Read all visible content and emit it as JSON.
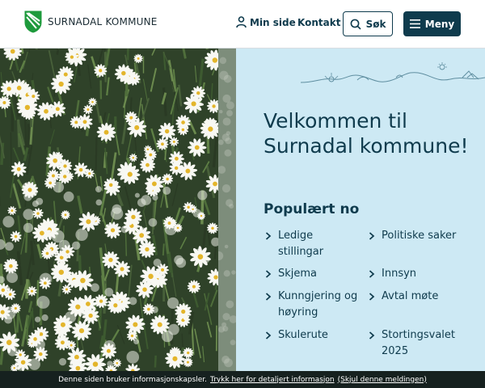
{
  "header": {
    "logo_text": "SURNADAL KOMMUNE",
    "min_side": "Min side",
    "kontakt": "Kontakt",
    "sok": "Søk",
    "meny": "Meny"
  },
  "hero": {
    "title": "Velkommen til Surnadal kommune!"
  },
  "popular": {
    "title": "Populært no",
    "links": [
      "Ledige stillingar",
      "Politiske saker",
      "Skjema",
      "Innsyn",
      "Kunngjering og høyring",
      "Avtal møte",
      "Skulerute",
      "Stortingsvalet 2025"
    ]
  },
  "cookie": {
    "text": "Denne siden bruker informasjonskapsler.",
    "link": "Trykk her for detaljert informasjon",
    "dismiss": "(Skjul denne meldingen)"
  },
  "colors": {
    "primary": "#0f3b4d",
    "panel": "#cde9f4",
    "cookie_bar": "#16211f",
    "logo_green": "#1e9a3c"
  },
  "icons": [
    "coat-of-arms-logo",
    "person-icon",
    "search-icon",
    "hamburger-icon",
    "chevron-right-icon"
  ]
}
